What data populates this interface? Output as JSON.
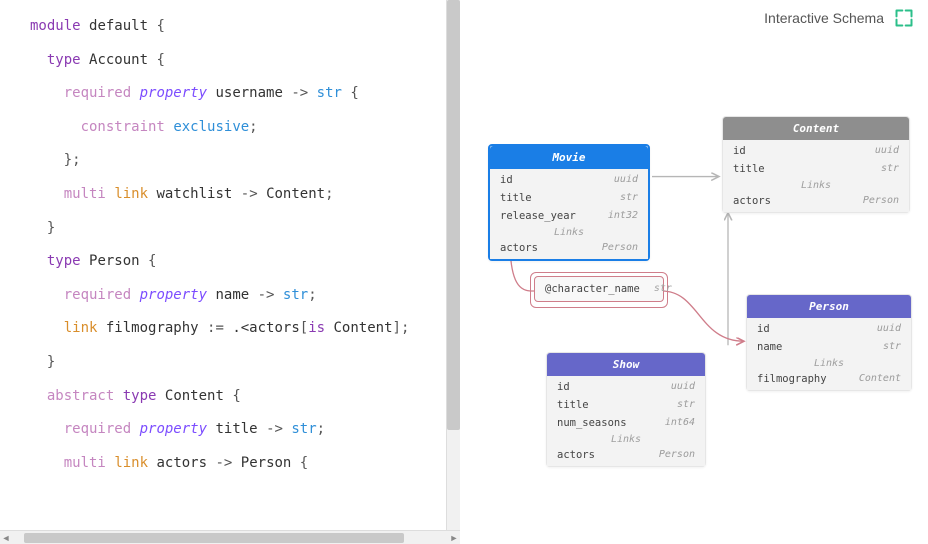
{
  "header": {
    "title": "Interactive Schema"
  },
  "code": {
    "tokens": [
      [
        [
          "kw-module",
          "module"
        ],
        [
          "",
          " "
        ],
        [
          "ident",
          "default"
        ],
        [
          "",
          " "
        ],
        [
          "punct",
          "{"
        ]
      ],
      [
        [
          "",
          "  "
        ],
        [
          "kw-type",
          "type"
        ],
        [
          "",
          " "
        ],
        [
          "ident",
          "Account"
        ],
        [
          "",
          " "
        ],
        [
          "punct",
          "{"
        ]
      ],
      [
        [
          "",
          "    "
        ],
        [
          "kw-req",
          "required"
        ],
        [
          "",
          " "
        ],
        [
          "kw-prop",
          "property"
        ],
        [
          "",
          " "
        ],
        [
          "ident",
          "username"
        ],
        [
          "",
          " "
        ],
        [
          "punct",
          "->"
        ],
        [
          "",
          " "
        ],
        [
          "ty-str",
          "str"
        ],
        [
          "",
          " "
        ],
        [
          "punct",
          "{"
        ]
      ],
      [
        [
          "",
          "      "
        ],
        [
          "kw-constraint",
          "constraint"
        ],
        [
          "",
          " "
        ],
        [
          "kw-excl",
          "exclusive"
        ],
        [
          "punct",
          ";"
        ]
      ],
      [
        [
          "",
          "    "
        ],
        [
          "punct",
          "};"
        ]
      ],
      [
        [
          "",
          "    "
        ],
        [
          "kw-multi",
          "multi"
        ],
        [
          "",
          " "
        ],
        [
          "kw-link",
          "link"
        ],
        [
          "",
          " "
        ],
        [
          "ident",
          "watchlist"
        ],
        [
          "",
          " "
        ],
        [
          "punct",
          "->"
        ],
        [
          "",
          " "
        ],
        [
          "ident",
          "Content"
        ],
        [
          "punct",
          ";"
        ]
      ],
      [
        [
          "",
          "  "
        ],
        [
          "punct",
          "}"
        ]
      ],
      [
        [
          "",
          ""
        ]
      ],
      [
        [
          "",
          "  "
        ],
        [
          "kw-type",
          "type"
        ],
        [
          "",
          " "
        ],
        [
          "ident",
          "Person"
        ],
        [
          "",
          " "
        ],
        [
          "punct",
          "{"
        ]
      ],
      [
        [
          "",
          "    "
        ],
        [
          "kw-req",
          "required"
        ],
        [
          "",
          " "
        ],
        [
          "kw-prop",
          "property"
        ],
        [
          "",
          " "
        ],
        [
          "ident",
          "name"
        ],
        [
          "",
          " "
        ],
        [
          "punct",
          "->"
        ],
        [
          "",
          " "
        ],
        [
          "ty-str",
          "str"
        ],
        [
          "punct",
          ";"
        ]
      ],
      [
        [
          "",
          "    "
        ],
        [
          "kw-link",
          "link"
        ],
        [
          "",
          " "
        ],
        [
          "ident",
          "filmography"
        ],
        [
          "",
          " "
        ],
        [
          "punct",
          ":="
        ],
        [
          "",
          " "
        ],
        [
          "ident",
          ".<actors"
        ],
        [
          "punct",
          "["
        ],
        [
          "kw-type",
          "is"
        ],
        [
          "",
          " "
        ],
        [
          "ident",
          "Content"
        ],
        [
          "punct",
          "];"
        ]
      ],
      [
        [
          "",
          "  "
        ],
        [
          "punct",
          "}"
        ]
      ],
      [
        [
          "",
          ""
        ]
      ],
      [
        [
          "",
          "  "
        ],
        [
          "kw-abstract",
          "abstract"
        ],
        [
          "",
          " "
        ],
        [
          "kw-type",
          "type"
        ],
        [
          "",
          " "
        ],
        [
          "ident",
          "Content"
        ],
        [
          "",
          " "
        ],
        [
          "punct",
          "{"
        ]
      ],
      [
        [
          "",
          "    "
        ],
        [
          "kw-req",
          "required"
        ],
        [
          "",
          " "
        ],
        [
          "kw-prop",
          "property"
        ],
        [
          "",
          " "
        ],
        [
          "ident",
          "title"
        ],
        [
          "",
          " "
        ],
        [
          "punct",
          "->"
        ],
        [
          "",
          " "
        ],
        [
          "ty-str",
          "str"
        ],
        [
          "punct",
          ";"
        ]
      ],
      [
        [
          "",
          "    "
        ],
        [
          "kw-multi",
          "multi"
        ],
        [
          "",
          " "
        ],
        [
          "kw-link",
          "link"
        ],
        [
          "",
          " "
        ],
        [
          "ident",
          "actors"
        ],
        [
          "",
          " "
        ],
        [
          "punct",
          "->"
        ],
        [
          "",
          " "
        ],
        [
          "ident",
          "Person"
        ],
        [
          "",
          " "
        ],
        [
          "punct",
          "{"
        ]
      ]
    ]
  },
  "schema": {
    "movie": {
      "title": "Movie",
      "props": [
        [
          "id",
          "uuid"
        ],
        [
          "title",
          "str"
        ],
        [
          "release_year",
          "int32"
        ]
      ],
      "links_label": "Links",
      "links": [
        [
          "actors",
          "Person"
        ]
      ]
    },
    "content": {
      "title": "Content",
      "props": [
        [
          "id",
          "uuid"
        ],
        [
          "title",
          "str"
        ]
      ],
      "links_label": "Links",
      "links": [
        [
          "actors",
          "Person"
        ]
      ]
    },
    "person": {
      "title": "Person",
      "props": [
        [
          "id",
          "uuid"
        ],
        [
          "name",
          "str"
        ]
      ],
      "links_label": "Links",
      "links": [
        [
          "filmography",
          "Content"
        ]
      ]
    },
    "show": {
      "title": "Show",
      "props": [
        [
          "id",
          "uuid"
        ],
        [
          "title",
          "str"
        ],
        [
          "num_seasons",
          "int64"
        ]
      ],
      "links_label": "Links",
      "links": [
        [
          "actors",
          "Person"
        ]
      ]
    },
    "linkprop": {
      "name": "@character_name",
      "type": "str"
    }
  }
}
